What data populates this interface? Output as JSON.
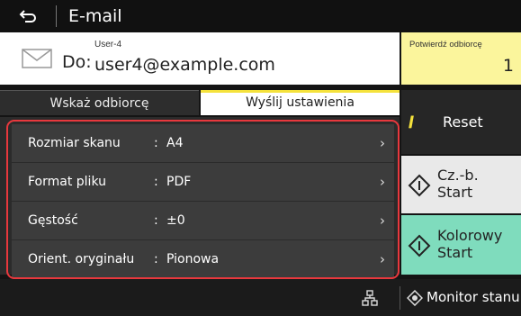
{
  "header": {
    "title": "E-mail",
    "back_icon": "back-arrow-icon"
  },
  "destination": {
    "prefix": "Do:",
    "user_name": "User-4",
    "email": "user4@example.com",
    "mail_icon": "envelope-icon"
  },
  "confirm": {
    "label": "Potwierdź odbiorcę",
    "count": "1"
  },
  "tabs": [
    {
      "label": "Wskaż odbiorcę",
      "active": false
    },
    {
      "label": "Wyślij ustawienia",
      "active": true
    }
  ],
  "settings": [
    {
      "label": "Rozmiar skanu",
      "value": "A4"
    },
    {
      "label": "Format pliku",
      "value": "PDF"
    },
    {
      "label": "Gęstość",
      "value": "±0"
    },
    {
      "label": "Orient. oryginału",
      "value": "Pionowa"
    }
  ],
  "separator": ":",
  "actions": {
    "reset_label": "Reset",
    "bw_start_line1": "Cz.-b.",
    "bw_start_line2": "Start",
    "color_start_line1": "Kolorowy",
    "color_start_line2": "Start"
  },
  "footer": {
    "monitor_label": "Monitor stanu",
    "network_icon": "network-icon",
    "monitor_icon": "status-monitor-icon"
  },
  "colors": {
    "highlight": "#e8383d",
    "confirm_bg": "#fbf59c",
    "color_start_bg": "#7fdcbd",
    "bw_start_bg": "#e9e9e9",
    "accent": "#f5e23c"
  }
}
